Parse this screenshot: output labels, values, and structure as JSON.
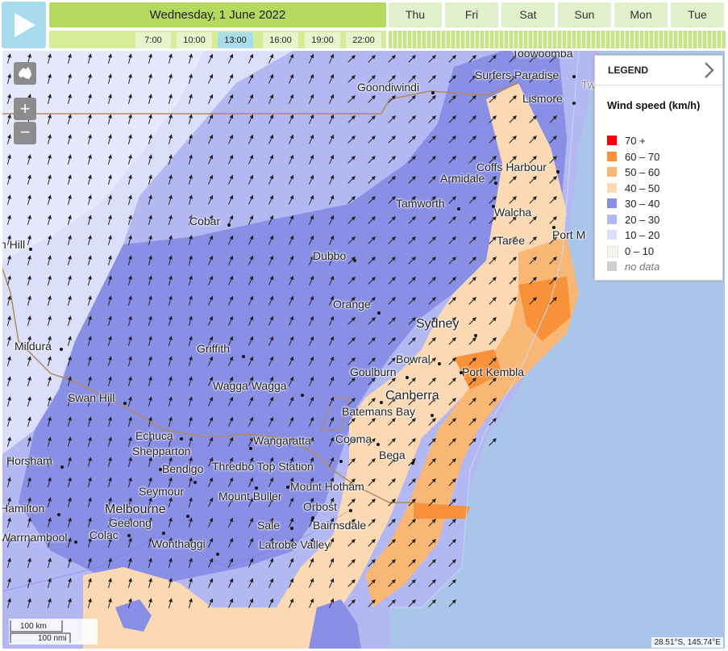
{
  "controls": {
    "date_label": "Wednesday, 1 June 2022",
    "days": [
      "Thu",
      "Fri",
      "Sat",
      "Sun",
      "Mon",
      "Tue"
    ],
    "hours": [
      "7:00",
      "10:00",
      "13:00",
      "16:00",
      "19:00",
      "22:00"
    ],
    "active_hour": "13:00"
  },
  "map": {
    "zoom_in": "+",
    "zoom_out": "−",
    "places": [
      "Toowoomba",
      "Goondiwindi",
      "Surfers Paradise",
      "Tweed Heads",
      "Lismore",
      "Coffs Harbour",
      "Armidale",
      "Tamworth",
      "Walcha",
      "Taree",
      "Port M",
      "Cobar",
      "Dubbo",
      "Orange",
      "Sydney",
      "Bowral",
      "Port Kembla",
      "Goulburn",
      "Canberra",
      "Batemans Bay",
      "Cooma",
      "Bega",
      "Griffith",
      "Wagga Wagga",
      "Mildura",
      "Swan Hill",
      "Echuca",
      "Shepparton",
      "Wangaratta",
      "Bendigo",
      "Thredbo Top Station",
      "Seymour",
      "Mount Buller",
      "Mount Hotham",
      "Orbost",
      "Melbourne",
      "Geelong",
      "Sale",
      "Bairnsdale",
      "Colac",
      "Wonthaggi",
      "Latrobe Valley",
      "Horsham",
      "Hamilton",
      "Warrnambool",
      "n Hill"
    ],
    "scale_km": "100 km",
    "scale_nmi": "100 nmi",
    "coordinates": "28.51°S, 145.74°E"
  },
  "legend": {
    "header": "LEGEND",
    "title": "Wind speed (km/h)",
    "items": [
      {
        "label": "70 +",
        "color": "#ff0000"
      },
      {
        "label": "60 – 70",
        "color": "#f7923a"
      },
      {
        "label": "50 – 60",
        "color": "#f9b776"
      },
      {
        "label": "40 – 50",
        "color": "#fcd9b5"
      },
      {
        "label": "30 – 40",
        "color": "#8a8fe6"
      },
      {
        "label": "20 – 30",
        "color": "#b3b7f2"
      },
      {
        "label": "10 – 20",
        "color": "#dcdff9"
      },
      {
        "label": "0 – 10",
        "color": "#f6f6ec"
      },
      {
        "label": "no data",
        "color": "#d0d0d0"
      }
    ]
  }
}
